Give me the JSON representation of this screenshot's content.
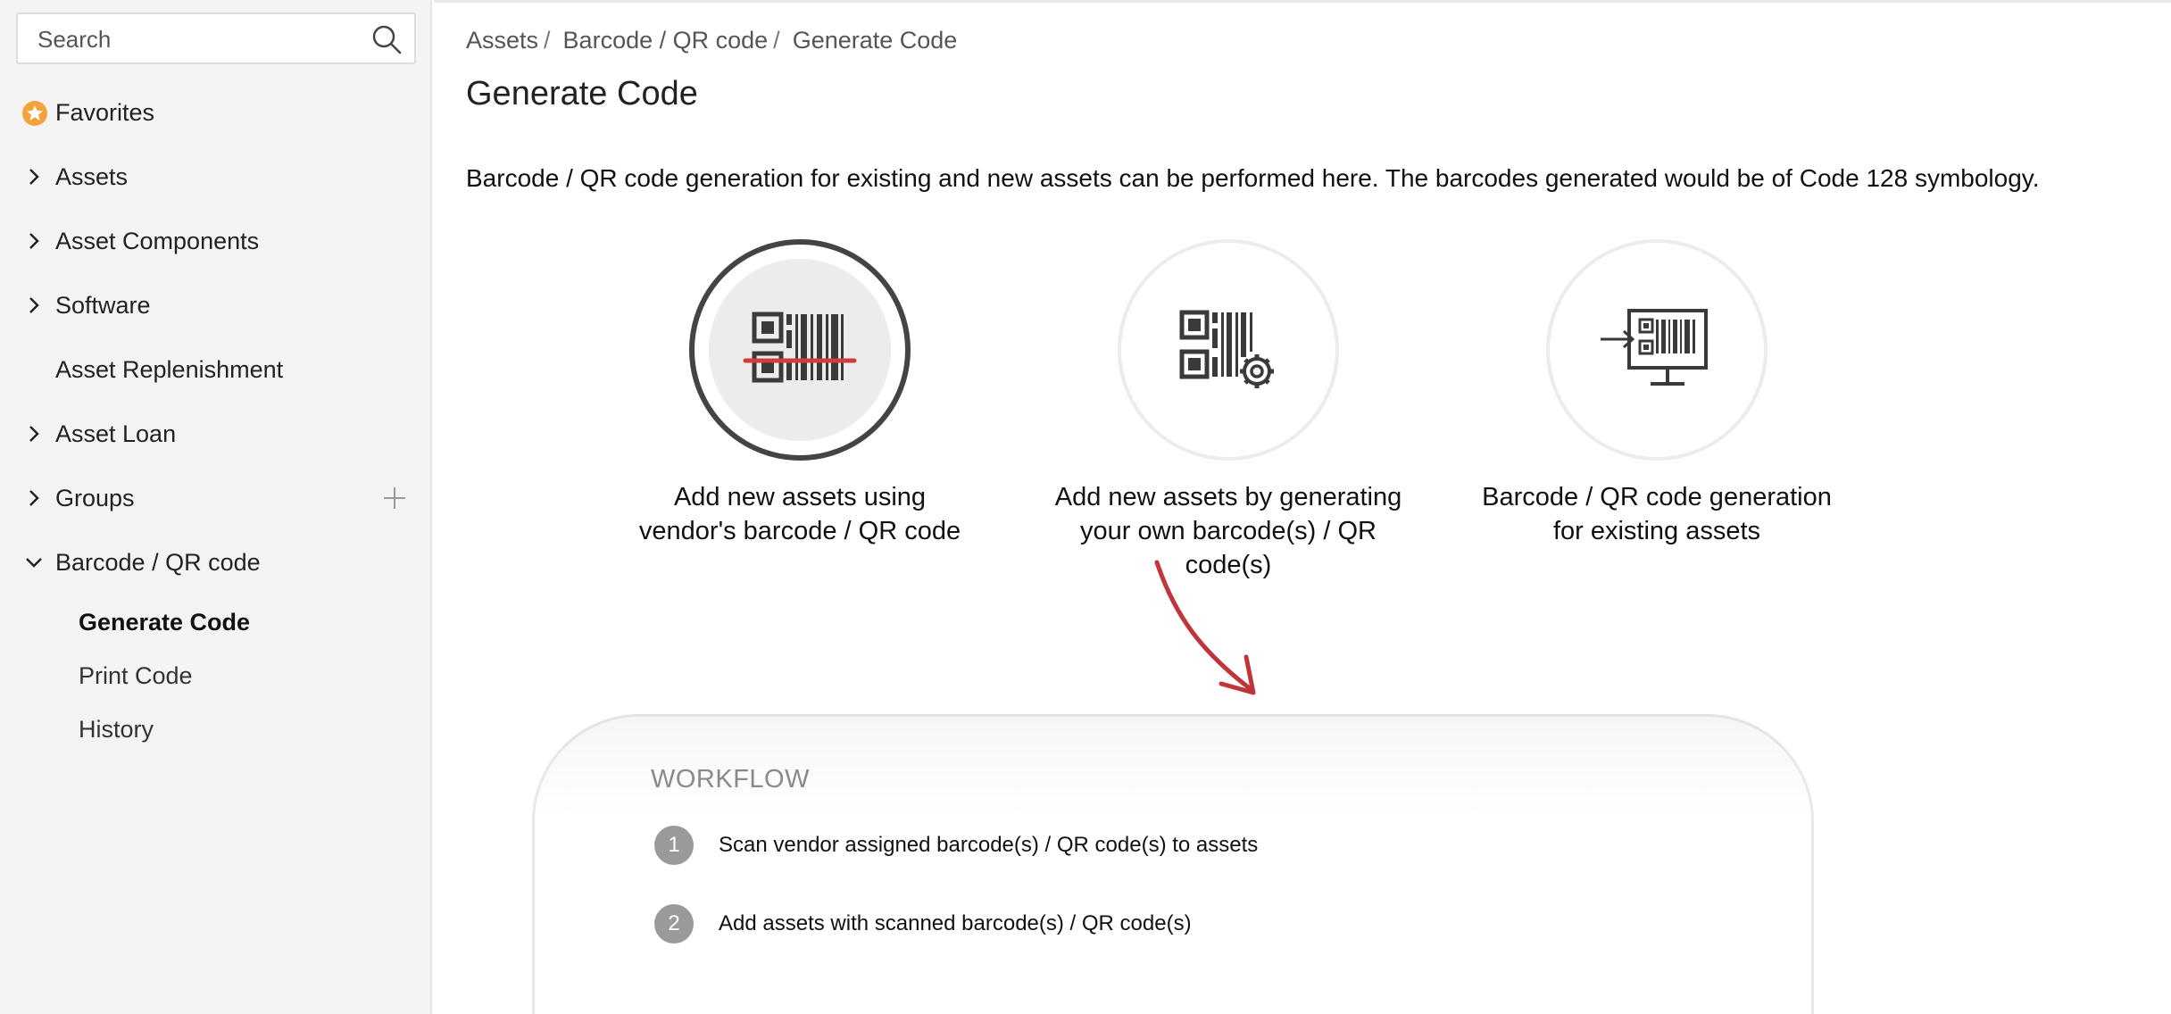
{
  "search": {
    "placeholder": "Search"
  },
  "sidebar": {
    "favorites": "Favorites",
    "items": [
      {
        "label": "Assets"
      },
      {
        "label": "Asset Components"
      },
      {
        "label": "Software"
      },
      {
        "label": "Asset Replenishment"
      },
      {
        "label": "Asset Loan"
      },
      {
        "label": "Groups"
      },
      {
        "label": "Barcode / QR code"
      }
    ],
    "sub_items": [
      {
        "label": "Generate Code",
        "active": true
      },
      {
        "label": "Print Code"
      },
      {
        "label": "History"
      }
    ]
  },
  "breadcrumb": {
    "assets": "Assets",
    "barcode": "Barcode / QR code",
    "current": "Generate Code",
    "separator": "/"
  },
  "page": {
    "title": "Generate Code",
    "description": "Barcode / QR code generation for existing and new assets can be performed here. The barcodes generated would be of Code 128 symbology."
  },
  "options": [
    {
      "line1": "Add new assets using",
      "line2": "vendor's barcode / QR code",
      "selected": true,
      "icon": "scan-barcode-icon"
    },
    {
      "line1": "Add new assets by generating",
      "line2": "your own barcode(s) / QR",
      "line3": "code(s)",
      "icon": "generate-barcode-icon"
    },
    {
      "line1": "Barcode / QR code generation",
      "line2": "for existing assets",
      "icon": "monitor-barcode-icon"
    }
  ],
  "workflow": {
    "title": "WORKFLOW",
    "steps": [
      {
        "num": "1",
        "text": "Scan vendor assigned barcode(s) / QR code(s) to assets"
      },
      {
        "num": "2",
        "text": "Add assets with scanned barcode(s) / QR code(s)"
      }
    ]
  },
  "colors": {
    "accent_red": "#d63b3b",
    "favorite_orange": "#f2a33a",
    "selected_ring": "#444444"
  }
}
